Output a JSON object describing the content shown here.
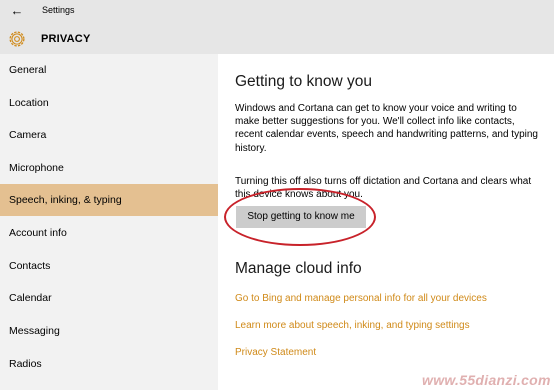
{
  "window": {
    "title": "Settings",
    "back_icon": "back-arrow-icon"
  },
  "header": {
    "icon": "gear-icon",
    "title": "PRIVACY"
  },
  "sidebar": {
    "items": [
      {
        "label": "General"
      },
      {
        "label": "Location"
      },
      {
        "label": "Camera"
      },
      {
        "label": "Microphone"
      },
      {
        "label": "Speech, inking, & typing",
        "selected": true
      },
      {
        "label": "Account info"
      },
      {
        "label": "Contacts"
      },
      {
        "label": "Calendar"
      },
      {
        "label": "Messaging"
      },
      {
        "label": "Radios"
      }
    ]
  },
  "main": {
    "section1_title": "Getting to know you",
    "section1_body": "Windows and Cortana can get to know your voice and writing to make better suggestions for you. We'll collect info like contacts, recent calendar events, speech and handwriting patterns, and typing history.",
    "section1_note": "Turning this off also turns off dictation and Cortana and clears what this device knows about you.",
    "stop_button_label": "Stop getting to know me",
    "section2_title": "Manage cloud info",
    "links": [
      {
        "label": "Go to Bing and manage personal info for all your devices"
      },
      {
        "label": "Learn more about speech, inking, and typing settings"
      },
      {
        "label": "Privacy Statement"
      }
    ]
  },
  "watermark": "www.55dianzi.com",
  "colors": {
    "accent_selected": "#e4c091",
    "link": "#d08a19",
    "annotation_ring": "#c8222a"
  }
}
